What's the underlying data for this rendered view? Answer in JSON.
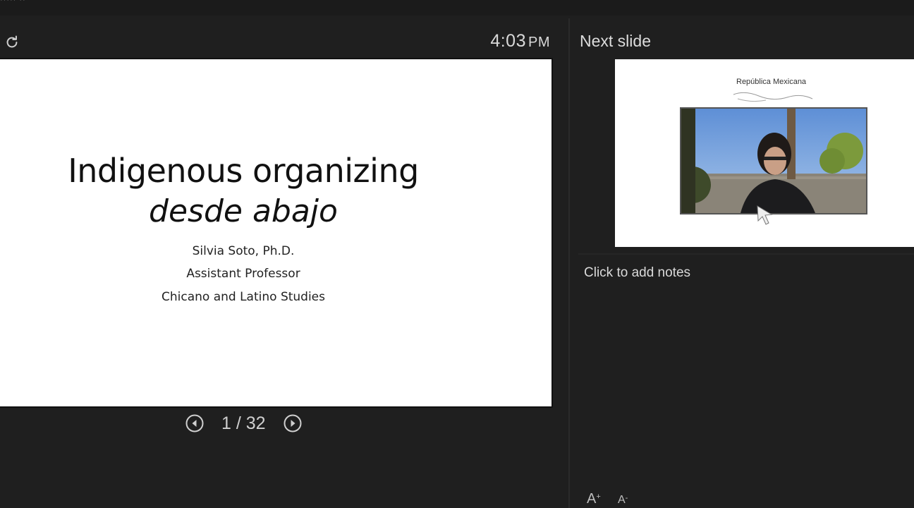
{
  "header": {
    "cropped_menu_text": "·····   ··",
    "clock_time": "4:03",
    "clock_ampm": "PM"
  },
  "current_slide": {
    "title": "Indigenous organizing",
    "subtitle": "desde abajo",
    "author": "Silvia Soto, Ph.D.",
    "position": "Assistant Professor",
    "department": "Chicano and Latino Studies",
    "background_color": "#ffffff"
  },
  "navigation": {
    "counter": "1 / 32",
    "prev_icon": "chevron-left-circle-icon",
    "next_icon": "chevron-right-circle-icon"
  },
  "next_slide_panel": {
    "label": "Next slide",
    "thumbnail_caption": "República Mexicana"
  },
  "notes": {
    "placeholder": "Click to add notes"
  },
  "font_controls": {
    "increase_label": "A",
    "decrease_label": "A"
  },
  "colors": {
    "background": "#1f1f1f",
    "divider": "#2a2a2a",
    "text": "#dcdcdc"
  }
}
